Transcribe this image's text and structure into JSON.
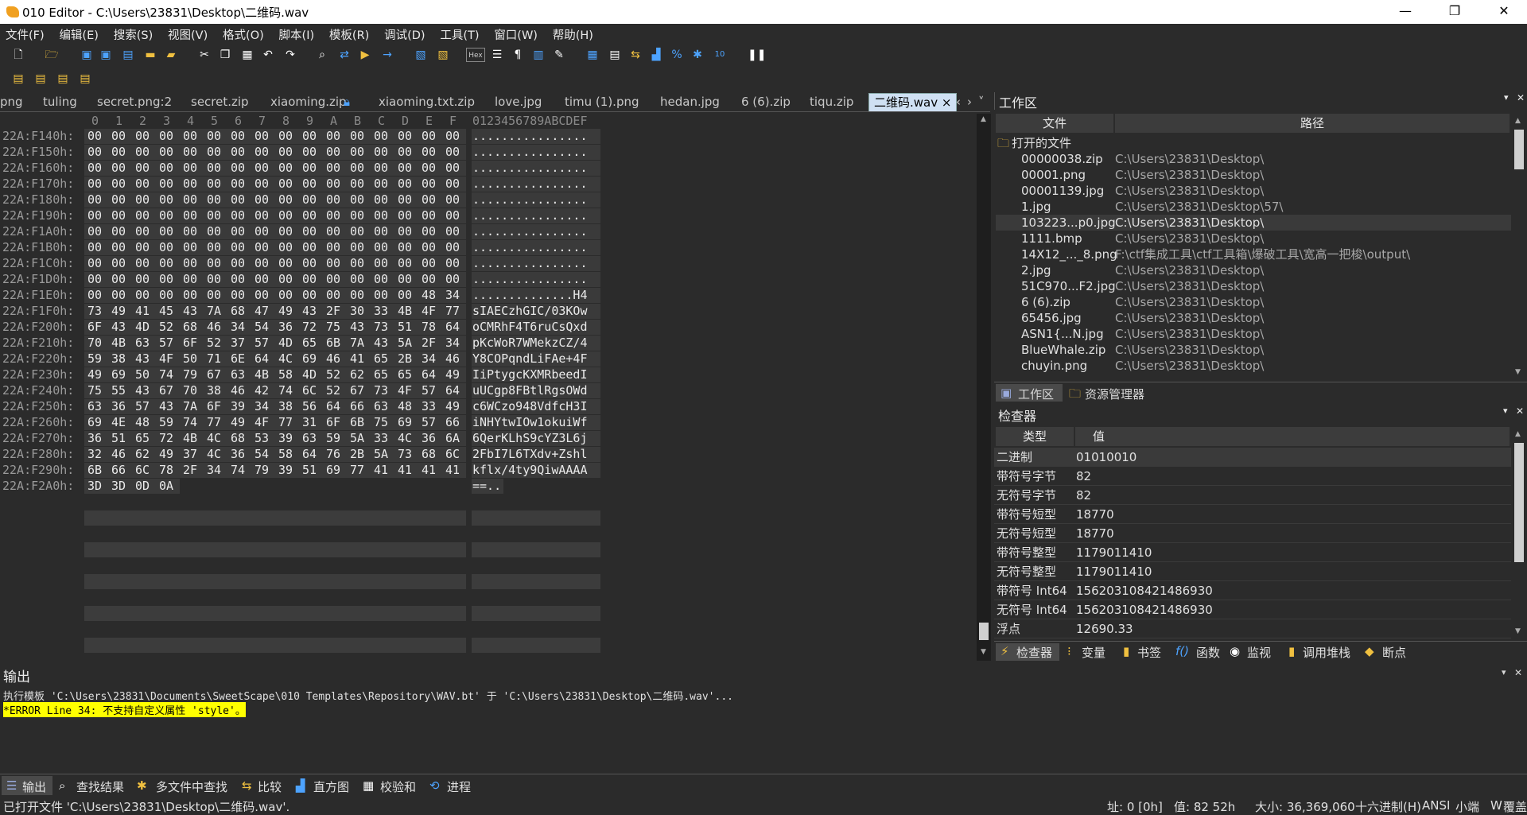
{
  "window": {
    "title": "010 Editor - C:\\Users\\23831\\Desktop\\二维码.wav",
    "minimize": "—",
    "maximize": "❐",
    "close": "✕"
  },
  "menu": [
    "文件(F)",
    "编辑(E)",
    "搜索(S)",
    "视图(V)",
    "格式(O)",
    "脚本(I)",
    "模板(R)",
    "调试(D)",
    "工具(T)",
    "窗口(W)",
    "帮助(H)"
  ],
  "tabs": [
    {
      "label": "png"
    },
    {
      "label": "tuling"
    },
    {
      "label": "secret.png:2"
    },
    {
      "label": "secret.zip"
    },
    {
      "label": "xiaoming.zip",
      "locked": true
    },
    {
      "label": "xiaoming.txt.zip"
    },
    {
      "label": "love.jpg"
    },
    {
      "label": "timu (1).png"
    },
    {
      "label": "hedan.jpg"
    },
    {
      "label": "6 (6).zip"
    },
    {
      "label": "tiqu.zip"
    },
    {
      "label": "二维码.wav",
      "active": true
    }
  ],
  "tab_close": "×",
  "tab_nav": [
    "‹",
    "›",
    "˅"
  ],
  "hex": {
    "header_cols": [
      "0",
      "1",
      "2",
      "3",
      "4",
      "5",
      "6",
      "7",
      "8",
      "9",
      "A",
      "B",
      "C",
      "D",
      "E",
      "F"
    ],
    "header_ascii": "0123456789ABCDEF",
    "rows": [
      {
        "addr": "22A:F140h:",
        "bytes": [
          "00",
          "00",
          "00",
          "00",
          "00",
          "00",
          "00",
          "00",
          "00",
          "00",
          "00",
          "00",
          "00",
          "00",
          "00",
          "00"
        ],
        "ascii": "................"
      },
      {
        "addr": "22A:F150h:",
        "bytes": [
          "00",
          "00",
          "00",
          "00",
          "00",
          "00",
          "00",
          "00",
          "00",
          "00",
          "00",
          "00",
          "00",
          "00",
          "00",
          "00"
        ],
        "ascii": "................"
      },
      {
        "addr": "22A:F160h:",
        "bytes": [
          "00",
          "00",
          "00",
          "00",
          "00",
          "00",
          "00",
          "00",
          "00",
          "00",
          "00",
          "00",
          "00",
          "00",
          "00",
          "00"
        ],
        "ascii": "................"
      },
      {
        "addr": "22A:F170h:",
        "bytes": [
          "00",
          "00",
          "00",
          "00",
          "00",
          "00",
          "00",
          "00",
          "00",
          "00",
          "00",
          "00",
          "00",
          "00",
          "00",
          "00"
        ],
        "ascii": "................"
      },
      {
        "addr": "22A:F180h:",
        "bytes": [
          "00",
          "00",
          "00",
          "00",
          "00",
          "00",
          "00",
          "00",
          "00",
          "00",
          "00",
          "00",
          "00",
          "00",
          "00",
          "00"
        ],
        "ascii": "................"
      },
      {
        "addr": "22A:F190h:",
        "bytes": [
          "00",
          "00",
          "00",
          "00",
          "00",
          "00",
          "00",
          "00",
          "00",
          "00",
          "00",
          "00",
          "00",
          "00",
          "00",
          "00"
        ],
        "ascii": "................"
      },
      {
        "addr": "22A:F1A0h:",
        "bytes": [
          "00",
          "00",
          "00",
          "00",
          "00",
          "00",
          "00",
          "00",
          "00",
          "00",
          "00",
          "00",
          "00",
          "00",
          "00",
          "00"
        ],
        "ascii": "................"
      },
      {
        "addr": "22A:F1B0h:",
        "bytes": [
          "00",
          "00",
          "00",
          "00",
          "00",
          "00",
          "00",
          "00",
          "00",
          "00",
          "00",
          "00",
          "00",
          "00",
          "00",
          "00"
        ],
        "ascii": "................"
      },
      {
        "addr": "22A:F1C0h:",
        "bytes": [
          "00",
          "00",
          "00",
          "00",
          "00",
          "00",
          "00",
          "00",
          "00",
          "00",
          "00",
          "00",
          "00",
          "00",
          "00",
          "00"
        ],
        "ascii": "................"
      },
      {
        "addr": "22A:F1D0h:",
        "bytes": [
          "00",
          "00",
          "00",
          "00",
          "00",
          "00",
          "00",
          "00",
          "00",
          "00",
          "00",
          "00",
          "00",
          "00",
          "00",
          "00"
        ],
        "ascii": "................"
      },
      {
        "addr": "22A:F1E0h:",
        "bytes": [
          "00",
          "00",
          "00",
          "00",
          "00",
          "00",
          "00",
          "00",
          "00",
          "00",
          "00",
          "00",
          "00",
          "00",
          "48",
          "34"
        ],
        "ascii": "..............H4"
      },
      {
        "addr": "22A:F1F0h:",
        "bytes": [
          "73",
          "49",
          "41",
          "45",
          "43",
          "7A",
          "68",
          "47",
          "49",
          "43",
          "2F",
          "30",
          "33",
          "4B",
          "4F",
          "77"
        ],
        "ascii": "sIAECzhGIC/03KOw"
      },
      {
        "addr": "22A:F200h:",
        "bytes": [
          "6F",
          "43",
          "4D",
          "52",
          "68",
          "46",
          "34",
          "54",
          "36",
          "72",
          "75",
          "43",
          "73",
          "51",
          "78",
          "64"
        ],
        "ascii": "oCMRhF4T6ruCsQxd"
      },
      {
        "addr": "22A:F210h:",
        "bytes": [
          "70",
          "4B",
          "63",
          "57",
          "6F",
          "52",
          "37",
          "57",
          "4D",
          "65",
          "6B",
          "7A",
          "43",
          "5A",
          "2F",
          "34"
        ],
        "ascii": "pKcWoR7WMekzCZ/4"
      },
      {
        "addr": "22A:F220h:",
        "bytes": [
          "59",
          "38",
          "43",
          "4F",
          "50",
          "71",
          "6E",
          "64",
          "4C",
          "69",
          "46",
          "41",
          "65",
          "2B",
          "34",
          "46"
        ],
        "ascii": "Y8COPqndLiFAe+4F"
      },
      {
        "addr": "22A:F230h:",
        "bytes": [
          "49",
          "69",
          "50",
          "74",
          "79",
          "67",
          "63",
          "4B",
          "58",
          "4D",
          "52",
          "62",
          "65",
          "65",
          "64",
          "49"
        ],
        "ascii": "IiPtygcKXMRbeedI"
      },
      {
        "addr": "22A:F240h:",
        "bytes": [
          "75",
          "55",
          "43",
          "67",
          "70",
          "38",
          "46",
          "42",
          "74",
          "6C",
          "52",
          "67",
          "73",
          "4F",
          "57",
          "64"
        ],
        "ascii": "uUCgp8FBtlRgsOWd"
      },
      {
        "addr": "22A:F250h:",
        "bytes": [
          "63",
          "36",
          "57",
          "43",
          "7A",
          "6F",
          "39",
          "34",
          "38",
          "56",
          "64",
          "66",
          "63",
          "48",
          "33",
          "49"
        ],
        "ascii": "c6WCzo948VdfcH3I"
      },
      {
        "addr": "22A:F260h:",
        "bytes": [
          "69",
          "4E",
          "48",
          "59",
          "74",
          "77",
          "49",
          "4F",
          "77",
          "31",
          "6F",
          "6B",
          "75",
          "69",
          "57",
          "66"
        ],
        "ascii": "iNHYtwIOw1okuiWf"
      },
      {
        "addr": "22A:F270h:",
        "bytes": [
          "36",
          "51",
          "65",
          "72",
          "4B",
          "4C",
          "68",
          "53",
          "39",
          "63",
          "59",
          "5A",
          "33",
          "4C",
          "36",
          "6A"
        ],
        "ascii": "6QerKLhS9cYZ3L6j"
      },
      {
        "addr": "22A:F280h:",
        "bytes": [
          "32",
          "46",
          "62",
          "49",
          "37",
          "4C",
          "36",
          "54",
          "58",
          "64",
          "76",
          "2B",
          "5A",
          "73",
          "68",
          "6C"
        ],
        "ascii": "2FbI7L6TXdv+Zshl"
      },
      {
        "addr": "22A:F290h:",
        "bytes": [
          "6B",
          "66",
          "6C",
          "78",
          "2F",
          "34",
          "74",
          "79",
          "39",
          "51",
          "69",
          "77",
          "41",
          "41",
          "41",
          "41"
        ],
        "ascii": "kflx/4ty9QiwAAAA"
      },
      {
        "addr": "22A:F2A0h:",
        "bytes": [
          "3D",
          "3D",
          "0D",
          "0A"
        ],
        "ascii": "==.."
      }
    ]
  },
  "workspace": {
    "title": "工作区",
    "col_file": "文件",
    "col_path": "路径",
    "group": "打开的文件",
    "files": [
      {
        "name": "00000038.zip",
        "path": "C:\\Users\\23831\\Desktop\\"
      },
      {
        "name": "00001.png",
        "path": "C:\\Users\\23831\\Desktop\\"
      },
      {
        "name": "00001139.jpg",
        "path": "C:\\Users\\23831\\Desktop\\"
      },
      {
        "name": "1.jpg",
        "path": "C:\\Users\\23831\\Desktop\\57\\"
      },
      {
        "name": "103223...p0.jpg",
        "path": "C:\\Users\\23831\\Desktop\\",
        "selected": true
      },
      {
        "name": "1111.bmp",
        "path": "C:\\Users\\23831\\Desktop\\"
      },
      {
        "name": "14X12_..._8.png",
        "path": "F:\\ctf集成工具\\ctf工具箱\\爆破工具\\宽高一把梭\\output\\"
      },
      {
        "name": "2.jpg",
        "path": "C:\\Users\\23831\\Desktop\\"
      },
      {
        "name": "51C970...F2.jpg",
        "path": "C:\\Users\\23831\\Desktop\\"
      },
      {
        "name": "6 (6).zip",
        "path": "C:\\Users\\23831\\Desktop\\"
      },
      {
        "name": "65456.jpg",
        "path": "C:\\Users\\23831\\Desktop\\"
      },
      {
        "name": "ASN1{...N.jpg",
        "path": "C:\\Users\\23831\\Desktop\\"
      },
      {
        "name": "BlueWhale.zip",
        "path": "C:\\Users\\23831\\Desktop\\"
      },
      {
        "name": "chuyin.png",
        "path": "C:\\Users\\23831\\Desktop\\"
      }
    ],
    "tabs": [
      "工作区",
      "资源管理器"
    ]
  },
  "inspector": {
    "title": "检查器",
    "col_type": "类型",
    "col_value": "值",
    "rows": [
      {
        "type": "二进制",
        "value": "01010010"
      },
      {
        "type": "带符号字节",
        "value": "82"
      },
      {
        "type": "无符号字节",
        "value": "82"
      },
      {
        "type": "带符号短型",
        "value": "18770"
      },
      {
        "type": "无符号短型",
        "value": "18770"
      },
      {
        "type": "带符号整型",
        "value": "1179011410"
      },
      {
        "type": "无符号整型",
        "value": "1179011410"
      },
      {
        "type": "带符号 Int64",
        "value": "156203108421486930"
      },
      {
        "type": "无符号 Int64",
        "value": "156203108421486930"
      },
      {
        "type": "浮点",
        "value": "12690.33"
      }
    ],
    "tabs": [
      "检查器",
      "变量",
      "书签",
      "函数",
      "监视",
      "调用堆栈",
      "断点"
    ]
  },
  "output": {
    "title": "输出",
    "line1": "执行模板 'C:\\Users\\23831\\Documents\\SweetScape\\010 Templates\\Repository\\WAV.bt' 于 'C:\\Users\\23831\\Desktop\\二维码.wav'...",
    "line2": "*ERROR Line 34: 不支持自定义属性 'style'。",
    "tabs": [
      "输出",
      "查找结果",
      "多文件中查找",
      "比较",
      "直方图",
      "校验和",
      "进程"
    ]
  },
  "status": {
    "left": "已打开文件 'C:\\Users\\23831\\Desktop\\二维码.wav'.",
    "pos": "址: 0 [0h]",
    "val": "值: 82 52h",
    "size": "大小: 36,369,060",
    "mode": "十六进制(H)",
    "enc": "ANSI",
    "endian": "小端",
    "rw": "W",
    "ovr": "覆盖"
  },
  "panel_ctrl": [
    "▾",
    "✕"
  ],
  "colors": {
    "bg": "#2b2b2b",
    "cell": "#3a3a3a",
    "active_tab": "#cfe0f3",
    "error_bg": "#ffff00"
  }
}
